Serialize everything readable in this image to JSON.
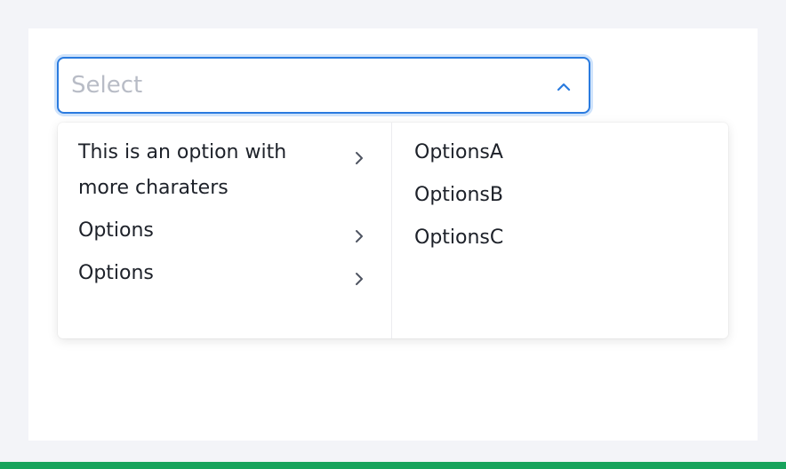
{
  "select": {
    "placeholder": "Select",
    "arrow_icon": "chevron-up-icon"
  },
  "cascader": {
    "level1": [
      {
        "label": "This is an option with more charaters",
        "icon": "chevron-right-icon"
      },
      {
        "label": "Options",
        "icon": "chevron-right-icon"
      },
      {
        "label": "Options",
        "icon": "chevron-right-icon"
      }
    ],
    "level2": [
      {
        "label": "OptionsA"
      },
      {
        "label": "OptionsB"
      },
      {
        "label": "OptionsC"
      }
    ]
  },
  "colors": {
    "accent": "#2a7bdf",
    "focus_ring": "#cfe3fb",
    "text": "#1d2129",
    "placeholder": "#b8bcc6",
    "bottom_bar": "#17a35c"
  }
}
